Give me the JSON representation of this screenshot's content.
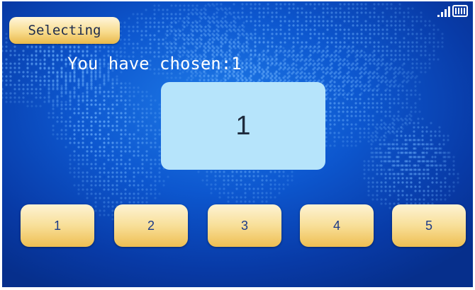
{
  "status": {
    "label": "Selecting"
  },
  "chosen_text": "You have chosen:1",
  "display_value": "1",
  "options": [
    {
      "label": "1"
    },
    {
      "label": "2"
    },
    {
      "label": "3"
    },
    {
      "label": "4"
    },
    {
      "label": "5"
    }
  ],
  "indicators": {
    "signal_icon": "signal-bars-icon",
    "battery_icon": "battery-icon"
  },
  "colors": {
    "background": "#0d57cf",
    "button": "#f8df98",
    "display": "#b6e4fb",
    "key_text": "#1c3a88"
  }
}
